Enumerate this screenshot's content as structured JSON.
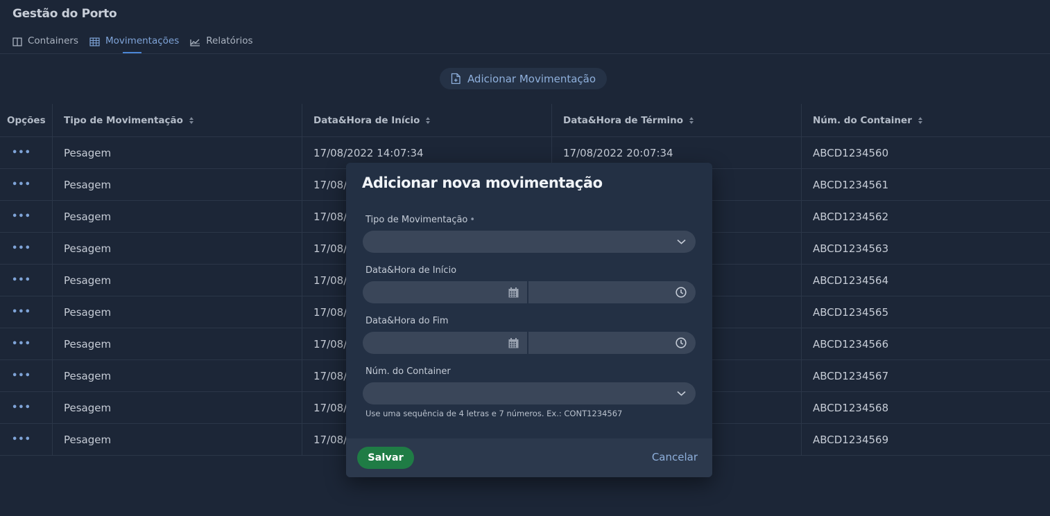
{
  "app": {
    "title": "Gestão do Porto"
  },
  "tabs": [
    {
      "label": "Containers",
      "icon": "columns-icon"
    },
    {
      "label": "Movimentações",
      "icon": "grid-table-icon",
      "active": true
    },
    {
      "label": "Relatórios",
      "icon": "chart-icon"
    }
  ],
  "add_button": {
    "label": "Adicionar Movimentação",
    "icon": "file-plus-icon"
  },
  "table": {
    "headers": [
      "Opções",
      "Tipo de Movimentação",
      "Data&Hora de Início",
      "Data&Hora de Término",
      "Núm. do Container"
    ],
    "rows": [
      {
        "tipo": "Pesagem",
        "inicio": "17/08/2022 14:07:34",
        "termino": "17/08/2022 20:07:34",
        "container": "ABCD1234560"
      },
      {
        "tipo": "Pesagem",
        "inicio": "17/08/2",
        "termino": "",
        "container": "ABCD1234561"
      },
      {
        "tipo": "Pesagem",
        "inicio": "17/08/2",
        "termino": "",
        "container": "ABCD1234562"
      },
      {
        "tipo": "Pesagem",
        "inicio": "17/08/2",
        "termino": "",
        "container": "ABCD1234563"
      },
      {
        "tipo": "Pesagem",
        "inicio": "17/08/2",
        "termino": "",
        "container": "ABCD1234564"
      },
      {
        "tipo": "Pesagem",
        "inicio": "17/08/2",
        "termino": "",
        "container": "ABCD1234565"
      },
      {
        "tipo": "Pesagem",
        "inicio": "17/08/2",
        "termino": "",
        "container": "ABCD1234566"
      },
      {
        "tipo": "Pesagem",
        "inicio": "17/08/2",
        "termino": "",
        "container": "ABCD1234567"
      },
      {
        "tipo": "Pesagem",
        "inicio": "17/08/2",
        "termino": "",
        "container": "ABCD1234568"
      },
      {
        "tipo": "Pesagem",
        "inicio": "17/08/2",
        "termino": "",
        "container": "ABCD1234569"
      }
    ],
    "options_glyph": "•••"
  },
  "modal": {
    "title": "Adicionar nova movimentação",
    "fields": {
      "tipo": {
        "label": "Tipo de Movimentação",
        "required_mark": "•",
        "value": ""
      },
      "inicio": {
        "label": "Data&Hora de Início",
        "date_value": "",
        "time_value": ""
      },
      "fim": {
        "label": "Data&Hora do Fim",
        "date_value": "",
        "time_value": ""
      },
      "container": {
        "label": "Núm. do Container",
        "value": "",
        "hint": "Use uma sequência de 4 letras e 7 números. Ex.: CONT1234567"
      }
    },
    "save_label": "Salvar",
    "cancel_label": "Cancelar"
  },
  "colors": {
    "background": "#1c2637",
    "accent": "#7fa4d8",
    "modal": "#233044",
    "save": "#1f7c45"
  }
}
